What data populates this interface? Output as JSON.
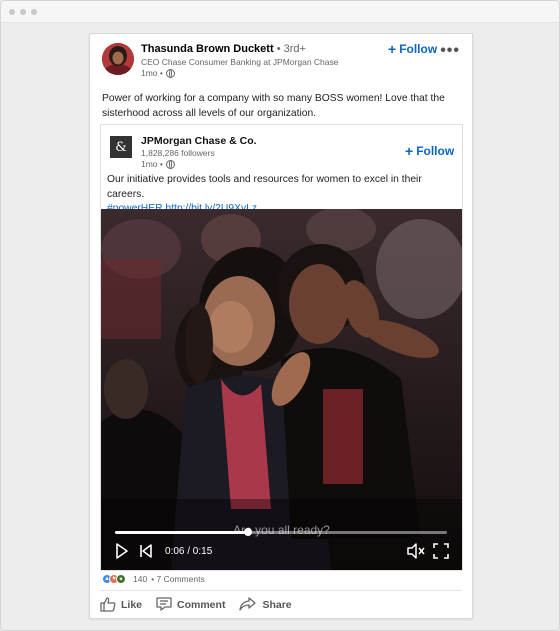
{
  "post": {
    "author": {
      "name": "Thasunda Brown Duckett",
      "degree": "• 3rd+",
      "headline": "CEO Chase Consumer Banking at JPMorgan Chase",
      "time": "1mo •"
    },
    "follow_label": "Follow",
    "more_label": "•••",
    "text": "Power of working for a company with so many BOSS women! Love that the sisterhood across all levels of our organization.",
    "shared": {
      "logo_glyph": "&",
      "org_name": "JPMorgan Chase & Co.",
      "followers": "1,828,286 followers",
      "time": "1mo •",
      "follow_label": "Follow",
      "text": "Our initiative provides tools and resources for women to excel in their careers.",
      "hashtag": "#powerHER",
      "link": "http://bit.ly/2U9XvLz",
      "video": {
        "caption": "Are you all ready?",
        "current_time": "0:06",
        "duration": "0:15",
        "time_readout": "0:06 / 0:15",
        "progress_fraction": 0.4,
        "icons": [
          "play-icon",
          "skip-back-icon",
          "mute-icon",
          "fullscreen-icon"
        ]
      }
    },
    "reactions": {
      "icons": [
        "like-reaction-icon",
        "love-reaction-icon",
        "celebrate-reaction-icon"
      ],
      "count": "140",
      "comments": "• 7 Comments"
    },
    "actions": [
      {
        "label": "Like",
        "icon": "thumbs-up-icon"
      },
      {
        "label": "Comment",
        "icon": "comment-icon"
      },
      {
        "label": "Share",
        "icon": "share-icon"
      }
    ]
  },
  "colors": {
    "accent": "#0a66c2",
    "like": "#378fe9",
    "love": "#df704d",
    "celebrate": "#44712e"
  }
}
